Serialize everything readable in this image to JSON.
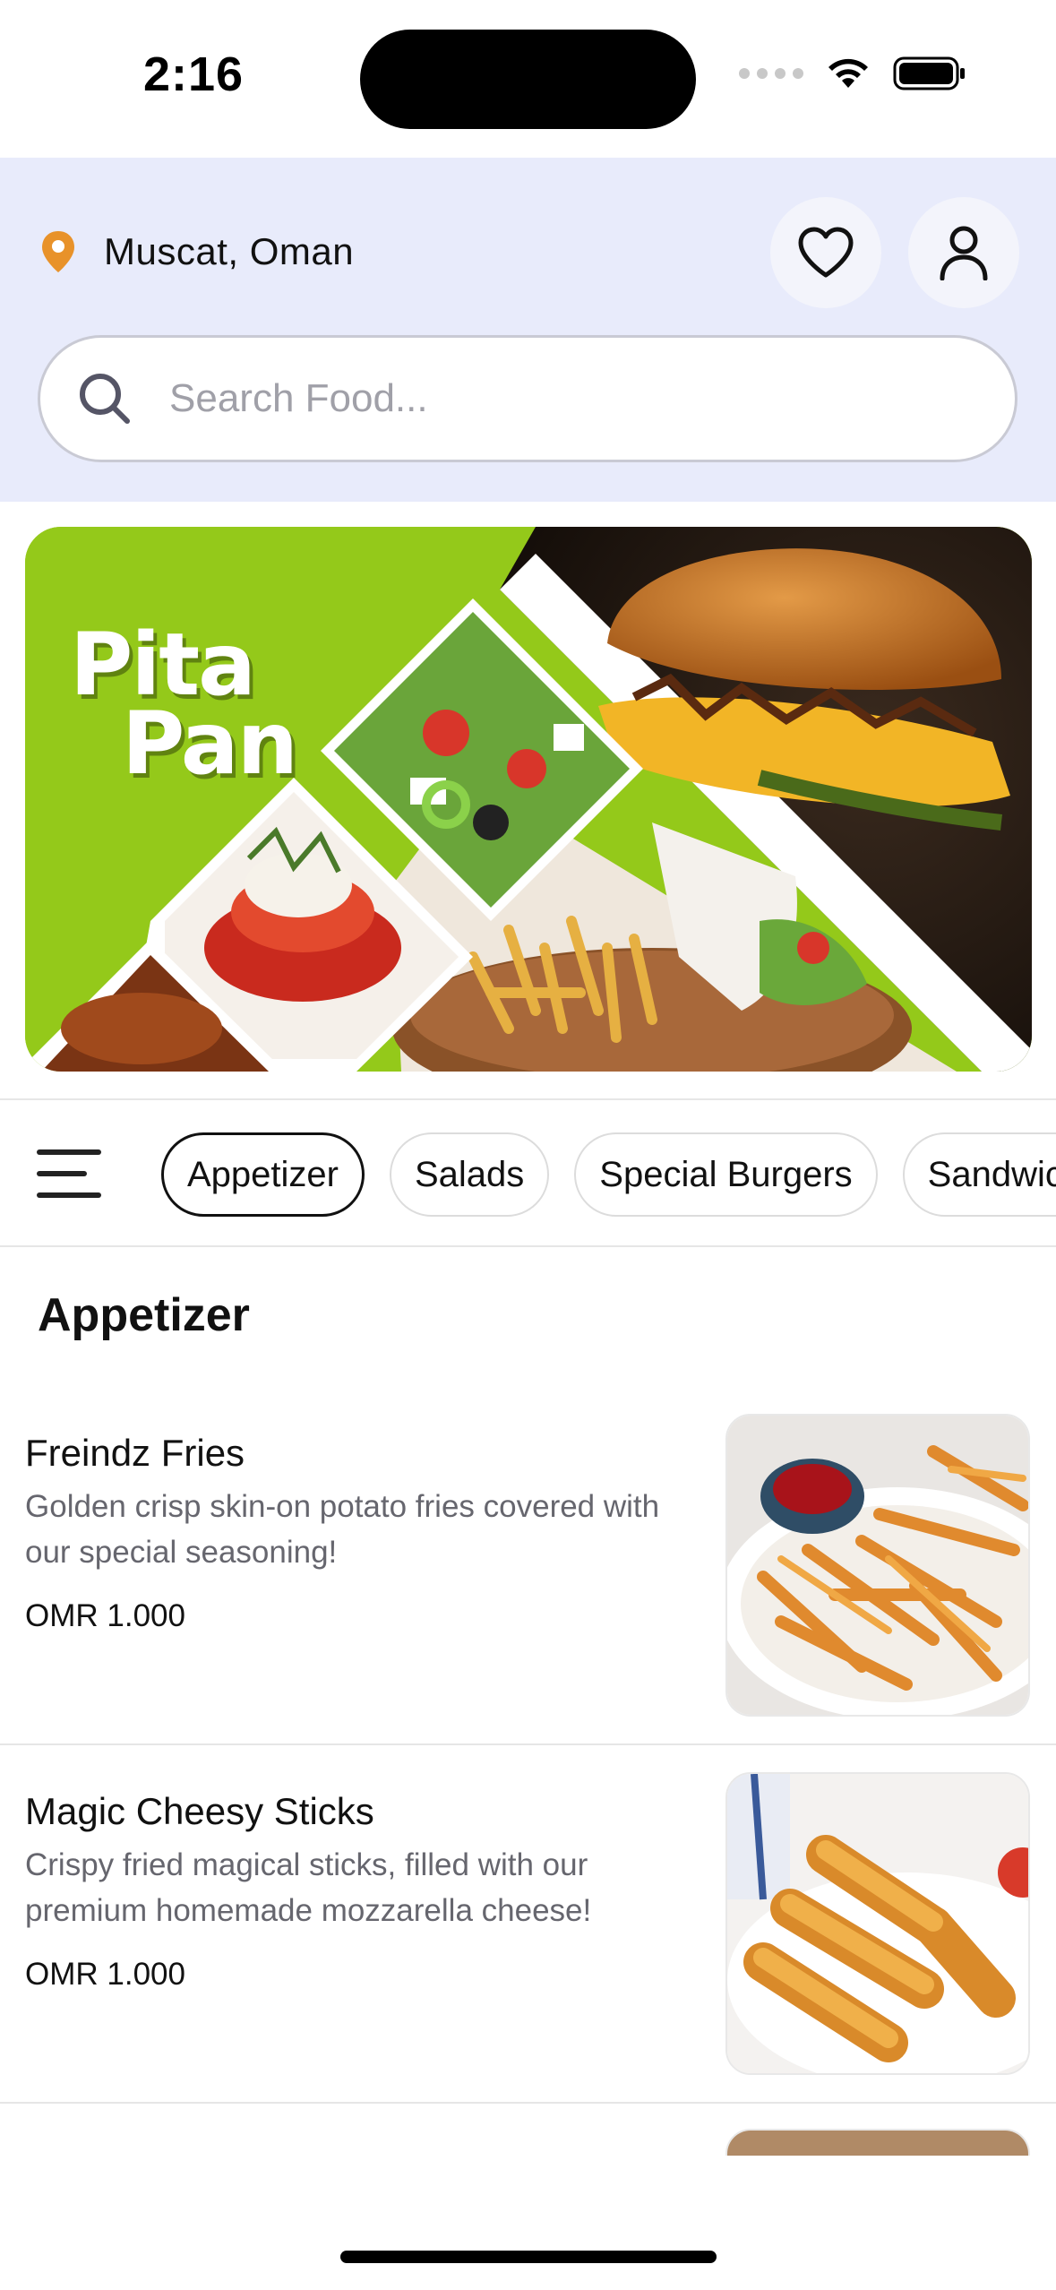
{
  "status_bar": {
    "time": "2:16"
  },
  "header": {
    "location": "Muscat, Oman",
    "search": {
      "placeholder": "Search Food..."
    }
  },
  "banner": {
    "line1": "Pita",
    "line2": "Pan"
  },
  "categories": {
    "items": [
      {
        "label": "Appetizer",
        "active": true
      },
      {
        "label": "Salads",
        "active": false
      },
      {
        "label": "Special Burgers",
        "active": false
      },
      {
        "label": "Sandwiches",
        "active": false
      }
    ]
  },
  "section": {
    "title": "Appetizer",
    "items": [
      {
        "name": "Freindz Fries",
        "description": "Golden crisp skin-on potato fries covered with our special seasoning!",
        "price": "OMR 1.000"
      },
      {
        "name": "Magic Cheesy Sticks",
        "description": "Crispy fried magical sticks, filled with our premium homemade mozzarella cheese!",
        "price": "OMR 1.000"
      }
    ]
  },
  "colors": {
    "header_bg": "#e8ebfb",
    "brand_green": "#94c91a",
    "location_pin": "#e8922a"
  }
}
